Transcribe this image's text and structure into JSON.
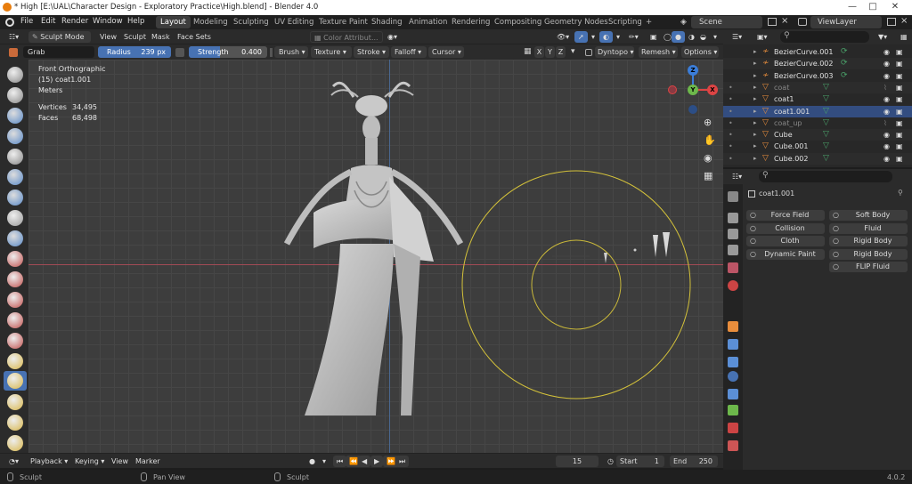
{
  "window": {
    "title": "* High [E:\\UAL\\Character Design - Exploratory Practice\\High.blend] - Blender 4.0"
  },
  "menu": [
    "File",
    "Edit",
    "Render",
    "Window",
    "Help"
  ],
  "workspaces": [
    "Layout",
    "Modeling",
    "Sculpting",
    "UV Editing",
    "Texture Paint",
    "Shading",
    "Animation",
    "Rendering",
    "Compositing",
    "Geometry Nodes",
    "Scripting",
    "+"
  ],
  "scene": {
    "label": "Scene",
    "view_layer": "ViewLayer"
  },
  "header": {
    "mode": "Sculpt Mode",
    "menus": [
      "View",
      "Sculpt",
      "Mask",
      "Face Sets"
    ],
    "color_attr": "Color Attribut..."
  },
  "tool_settings": {
    "brush": "Grab",
    "radius_label": "Radius",
    "radius_value": "239 px",
    "strength_label": "Strength",
    "strength_value": "0.400",
    "menus": [
      "Brush",
      "Texture",
      "Stroke",
      "Falloff",
      "Cursor"
    ],
    "axes": [
      "X",
      "Y",
      "Z"
    ],
    "dyntopo": "Dyntopo",
    "remesh": "Remesh",
    "options": "Options"
  },
  "viewport": {
    "view_name": "Front Orthographic",
    "object": "(15) coat1.001",
    "units": "Meters",
    "stats": [
      {
        "label": "Vertices",
        "value": "34,495"
      },
      {
        "label": "Faces",
        "value": "68,498"
      }
    ],
    "gizmo_axes": [
      "X",
      "Y",
      "Z"
    ]
  },
  "outliner": {
    "rows": [
      {
        "name": "BezierCurve.001",
        "kind": "curve",
        "dim": false,
        "selected": false
      },
      {
        "name": "BezierCurve.002",
        "kind": "curve",
        "dim": false,
        "selected": false
      },
      {
        "name": "BezierCurve.003",
        "kind": "curve",
        "dim": false,
        "selected": false
      },
      {
        "name": "coat",
        "kind": "mesh",
        "dim": true,
        "selected": false
      },
      {
        "name": "coat1",
        "kind": "mesh",
        "dim": false,
        "selected": false
      },
      {
        "name": "coat1.001",
        "kind": "mesh",
        "dim": false,
        "selected": true
      },
      {
        "name": "coat_up",
        "kind": "mesh",
        "dim": true,
        "selected": false
      },
      {
        "name": "Cube",
        "kind": "mesh",
        "dim": false,
        "selected": false
      },
      {
        "name": "Cube.001",
        "kind": "mesh",
        "dim": false,
        "selected": false
      },
      {
        "name": "Cube.002",
        "kind": "mesh",
        "dim": false,
        "selected": false
      }
    ]
  },
  "properties": {
    "object": "coat1.001",
    "physics_buttons": [
      [
        "Force Field",
        "Soft Body"
      ],
      [
        "Collision",
        "Fluid"
      ],
      [
        "Cloth",
        "Rigid Body"
      ],
      [
        "Dynamic Paint",
        "Rigid Body Constra..."
      ],
      [
        "",
        "FLIP Fluid"
      ]
    ]
  },
  "timeline": {
    "menus": [
      "Playback",
      "Keying",
      "View",
      "Marker"
    ],
    "current_frame": "15",
    "start_label": "Start",
    "start": "1",
    "end_label": "End",
    "end": "250"
  },
  "status": {
    "left": "Sculpt",
    "middle": "Pan View",
    "right": "Sculpt",
    "version": "4.0.2"
  },
  "colors": {
    "accent": "#4772b3",
    "brush_circle": "#d4c23a",
    "selected_row": "#334d80"
  }
}
